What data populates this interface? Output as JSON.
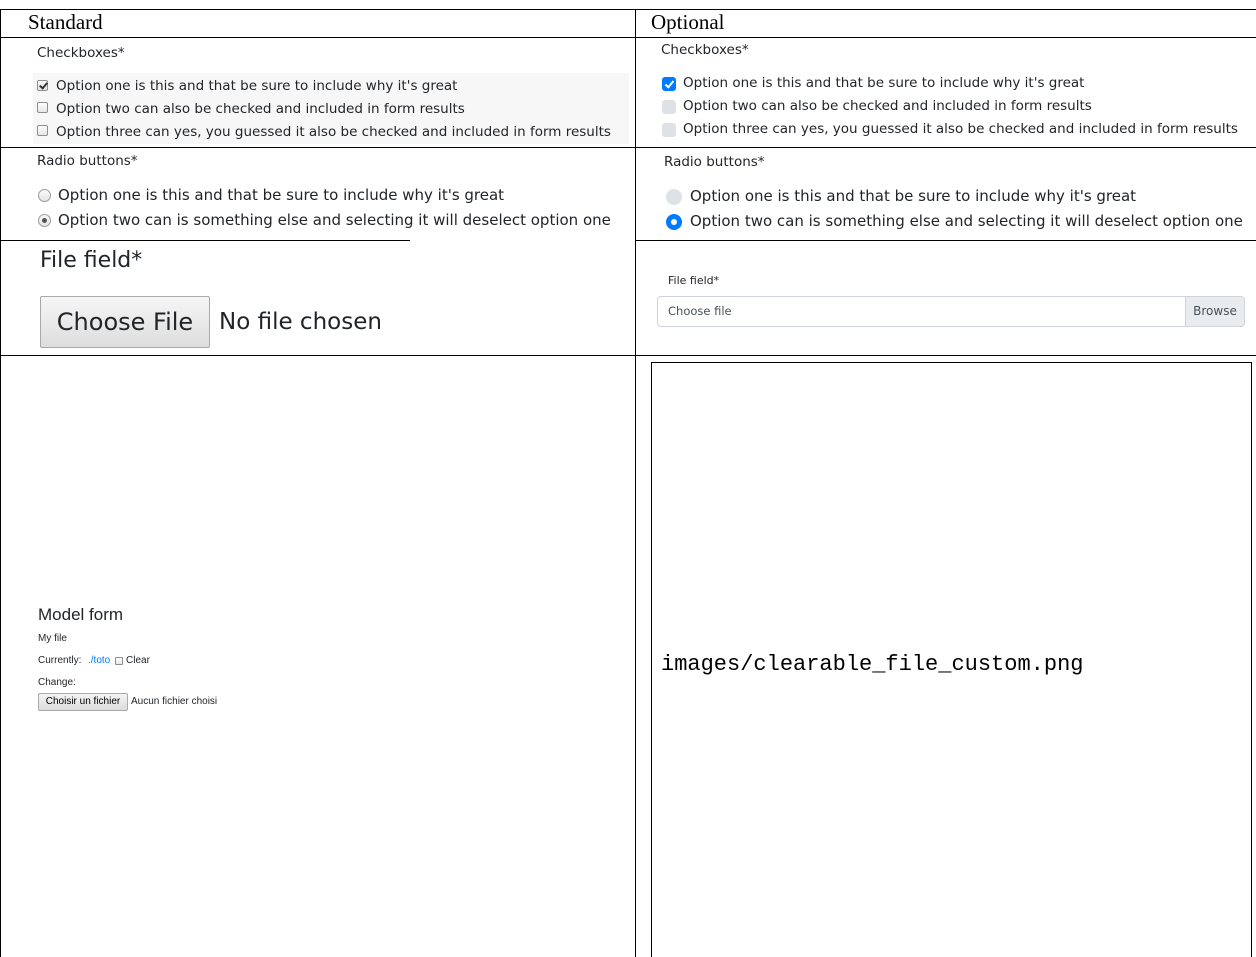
{
  "table": {
    "headers": [
      "Standard",
      "Optional"
    ]
  },
  "standard": {
    "checkboxes": {
      "label": "Checkboxes*",
      "options": [
        {
          "label": "Option one is this and that be sure to include why it's great",
          "checked": true
        },
        {
          "label": "Option two can also be checked and included in form results",
          "checked": false
        },
        {
          "label": "Option three can yes, you guessed it also be checked and included in form results",
          "checked": false
        }
      ]
    },
    "radios": {
      "label": "Radio buttons*",
      "options": [
        {
          "label": "Option one is this and that be sure to include why it's great",
          "checked": false
        },
        {
          "label": "Option two can is something else and selecting it will deselect option one",
          "checked": true
        }
      ]
    },
    "file_field": {
      "label": "File field*",
      "button": "Choose File",
      "status": "No file chosen"
    },
    "model_form": {
      "title": "Model form",
      "field_label": "My file",
      "currently_label": "Currently:",
      "current_link": "./toto",
      "clear_label": "Clear",
      "change_label": "Change:",
      "button": "Choisir un fichier",
      "status": "Aucun fichier choisi"
    }
  },
  "optional": {
    "checkboxes": {
      "label": "Checkboxes*",
      "options": [
        {
          "label": "Option one is this and that be sure to include why it's great",
          "checked": true
        },
        {
          "label": "Option two can also be checked and included in form results",
          "checked": false
        },
        {
          "label": "Option three can yes, you guessed it also be checked and included in form results",
          "checked": false
        }
      ]
    },
    "radios": {
      "label": "Radio buttons*",
      "options": [
        {
          "label": "Option one is this and that be sure to include why it's great",
          "checked": false
        },
        {
          "label": "Option two can is something else and selecting it will deselect option one",
          "checked": true
        }
      ]
    },
    "file_field": {
      "label": "File field*",
      "placeholder": "Choose file",
      "browse": "Browse"
    },
    "image_placeholder": "images/clearable_file_custom.png"
  },
  "colors": {
    "accent": "#007bff",
    "link": "#007bff",
    "text": "#212529"
  }
}
